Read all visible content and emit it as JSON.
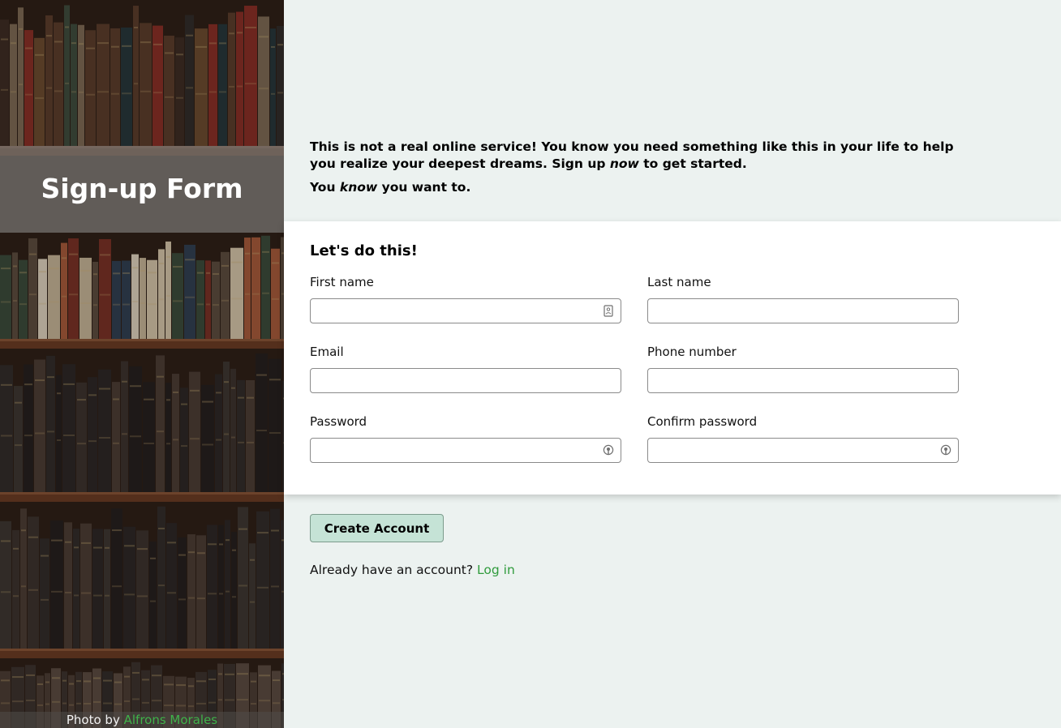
{
  "sidebar": {
    "title": "Sign-up Form",
    "photo_credit_prefix": "Photo by ",
    "photo_credit_author": "Alfrons Morales",
    "link_color": "#3fb24a"
  },
  "intro": {
    "line1_a": "This is not a real online service! You know you need something like this in your life to help you realize your deepest dreams. Sign up ",
    "line1_em": "now",
    "line1_b": " to get started.",
    "line2_a": "You ",
    "line2_em": "know",
    "line2_b": " you want to."
  },
  "form": {
    "heading": "Let's do this!",
    "fields": {
      "first_name": {
        "label": "First name",
        "value": "",
        "icon": "contact-card-icon"
      },
      "last_name": {
        "label": "Last name",
        "value": ""
      },
      "email": {
        "label": "Email",
        "value": ""
      },
      "phone": {
        "label": "Phone number",
        "value": ""
      },
      "password": {
        "label": "Password",
        "value": "",
        "icon": "password-key-icon"
      },
      "confirm_password": {
        "label": "Confirm password",
        "value": "",
        "icon": "password-key-icon"
      }
    }
  },
  "actions": {
    "create_label": "Create Account",
    "button_color": "#c5e3d6",
    "login_prompt": "Already have an account? ",
    "login_link": "Log in",
    "login_link_color": "#2f9b3c"
  },
  "colors": {
    "page_background": "#ecf2f0",
    "card_background": "#ffffff"
  }
}
